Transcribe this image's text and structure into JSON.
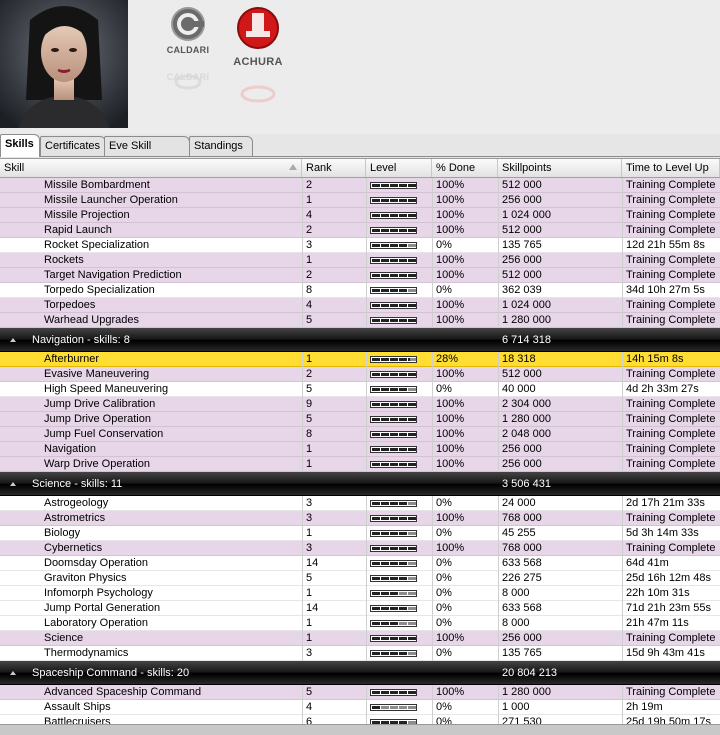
{
  "character": {
    "portrait_alt": "character-portrait"
  },
  "corps": [
    {
      "name": "CALDARI",
      "color": "#555555"
    },
    {
      "name": "ACHURA",
      "color": "#cc1111"
    }
  ],
  "tabs": [
    {
      "label": "Skills",
      "active": true
    },
    {
      "label": "Certificates",
      "active": false
    },
    {
      "label": "Eve Skill Queue",
      "active": false
    },
    {
      "label": "Standings",
      "active": false
    }
  ],
  "columns": [
    "Skill",
    "Rank",
    "Level",
    "% Done",
    "Skillpoints",
    "Time to Level Up"
  ],
  "rows": [
    {
      "type": "skill",
      "name": "Missile Bombardment",
      "rank": "2",
      "level": 5,
      "progress": 0,
      "done": "100%",
      "sp": "512 000",
      "time": "Training Complete"
    },
    {
      "type": "skill",
      "name": "Missile Launcher Operation",
      "rank": "1",
      "level": 5,
      "progress": 0,
      "done": "100%",
      "sp": "256 000",
      "time": "Training Complete"
    },
    {
      "type": "skill",
      "name": "Missile Projection",
      "rank": "4",
      "level": 5,
      "progress": 0,
      "done": "100%",
      "sp": "1 024 000",
      "time": "Training Complete"
    },
    {
      "type": "skill",
      "name": "Rapid Launch",
      "rank": "2",
      "level": 5,
      "progress": 0,
      "done": "100%",
      "sp": "512 000",
      "time": "Training Complete"
    },
    {
      "type": "skill",
      "name": "Rocket Specialization",
      "rank": "3",
      "level": 4,
      "progress": 0,
      "done": "0%",
      "sp": "135 765",
      "time": "12d 21h 55m 8s"
    },
    {
      "type": "skill",
      "name": "Rockets",
      "rank": "1",
      "level": 5,
      "progress": 0,
      "done": "100%",
      "sp": "256 000",
      "time": "Training Complete"
    },
    {
      "type": "skill",
      "name": "Target Navigation Prediction",
      "rank": "2",
      "level": 5,
      "progress": 0,
      "done": "100%",
      "sp": "512 000",
      "time": "Training Complete"
    },
    {
      "type": "skill",
      "name": "Torpedo Specialization",
      "rank": "8",
      "level": 4,
      "progress": 0,
      "done": "0%",
      "sp": "362 039",
      "time": "34d 10h 27m 5s"
    },
    {
      "type": "skill",
      "name": "Torpedoes",
      "rank": "4",
      "level": 5,
      "progress": 0,
      "done": "100%",
      "sp": "1 024 000",
      "time": "Training Complete"
    },
    {
      "type": "skill",
      "name": "Warhead Upgrades",
      "rank": "5",
      "level": 5,
      "progress": 0,
      "done": "100%",
      "sp": "1 280 000",
      "time": "Training Complete"
    },
    {
      "type": "group",
      "label": "Navigation - skills: 8",
      "sp": "6 714 318"
    },
    {
      "type": "skill",
      "name": "Afterburner",
      "rank": "1",
      "level": 4,
      "progress": 0.28,
      "done": "28%",
      "sp": "18 318",
      "time": "14h 15m 8s",
      "selected": true
    },
    {
      "type": "skill",
      "name": "Evasive Maneuvering",
      "rank": "2",
      "level": 5,
      "progress": 0,
      "done": "100%",
      "sp": "512 000",
      "time": "Training Complete"
    },
    {
      "type": "skill",
      "name": "High Speed Maneuvering",
      "rank": "5",
      "level": 4,
      "progress": 0,
      "done": "0%",
      "sp": "40 000",
      "time": "4d 2h 33m 27s"
    },
    {
      "type": "skill",
      "name": "Jump Drive Calibration",
      "rank": "9",
      "level": 5,
      "progress": 0,
      "done": "100%",
      "sp": "2 304 000",
      "time": "Training Complete"
    },
    {
      "type": "skill",
      "name": "Jump Drive Operation",
      "rank": "5",
      "level": 5,
      "progress": 0,
      "done": "100%",
      "sp": "1 280 000",
      "time": "Training Complete"
    },
    {
      "type": "skill",
      "name": "Jump Fuel Conservation",
      "rank": "8",
      "level": 5,
      "progress": 0,
      "done": "100%",
      "sp": "2 048 000",
      "time": "Training Complete"
    },
    {
      "type": "skill",
      "name": "Navigation",
      "rank": "1",
      "level": 5,
      "progress": 0,
      "done": "100%",
      "sp": "256 000",
      "time": "Training Complete"
    },
    {
      "type": "skill",
      "name": "Warp Drive Operation",
      "rank": "1",
      "level": 5,
      "progress": 0,
      "done": "100%",
      "sp": "256 000",
      "time": "Training Complete"
    },
    {
      "type": "group",
      "label": "Science - skills: 11",
      "sp": "3 506 431"
    },
    {
      "type": "skill",
      "name": "Astrogeology",
      "rank": "3",
      "level": 4,
      "progress": 0,
      "done": "0%",
      "sp": "24 000",
      "time": "2d 17h 21m 33s"
    },
    {
      "type": "skill",
      "name": "Astrometrics",
      "rank": "3",
      "level": 5,
      "progress": 0,
      "done": "100%",
      "sp": "768 000",
      "time": "Training Complete"
    },
    {
      "type": "skill",
      "name": "Biology",
      "rank": "1",
      "level": 4,
      "progress": 0,
      "done": "0%",
      "sp": "45 255",
      "time": "5d 3h 14m 33s"
    },
    {
      "type": "skill",
      "name": "Cybernetics",
      "rank": "3",
      "level": 5,
      "progress": 0,
      "done": "100%",
      "sp": "768 000",
      "time": "Training Complete"
    },
    {
      "type": "skill",
      "name": "Doomsday Operation",
      "rank": "14",
      "level": 4,
      "progress": 0,
      "done": "0%",
      "sp": "633 568",
      "time": "64d 41m"
    },
    {
      "type": "skill",
      "name": "Graviton Physics",
      "rank": "5",
      "level": 4,
      "progress": 0,
      "done": "0%",
      "sp": "226 275",
      "time": "25d 16h 12m 48s"
    },
    {
      "type": "skill",
      "name": "Infomorph Psychology",
      "rank": "1",
      "level": 3,
      "progress": 0,
      "done": "0%",
      "sp": "8 000",
      "time": "22h 10m 31s"
    },
    {
      "type": "skill",
      "name": "Jump Portal Generation",
      "rank": "14",
      "level": 4,
      "progress": 0,
      "done": "0%",
      "sp": "633 568",
      "time": "71d 21h 23m 55s"
    },
    {
      "type": "skill",
      "name": "Laboratory Operation",
      "rank": "1",
      "level": 3,
      "progress": 0,
      "done": "0%",
      "sp": "8 000",
      "time": "21h 47m 11s"
    },
    {
      "type": "skill",
      "name": "Science",
      "rank": "1",
      "level": 5,
      "progress": 0,
      "done": "100%",
      "sp": "256 000",
      "time": "Training Complete"
    },
    {
      "type": "skill",
      "name": "Thermodynamics",
      "rank": "3",
      "level": 4,
      "progress": 0,
      "done": "0%",
      "sp": "135 765",
      "time": "15d 9h 43m 41s"
    },
    {
      "type": "group",
      "label": "Spaceship Command - skills: 20",
      "sp": "20 804 213"
    },
    {
      "type": "skill",
      "name": "Advanced Spaceship Command",
      "rank": "5",
      "level": 5,
      "progress": 0,
      "done": "100%",
      "sp": "1 280 000",
      "time": "Training Complete"
    },
    {
      "type": "skill",
      "name": "Assault Ships",
      "rank": "4",
      "level": 1,
      "progress": 0,
      "done": "0%",
      "sp": "1 000",
      "time": "2h 19m"
    },
    {
      "type": "skill",
      "name": "Battlecruisers",
      "rank": "6",
      "level": 4,
      "progress": 0,
      "done": "0%",
      "sp": "271 530",
      "time": "25d 19h 50m 17s"
    }
  ],
  "colors": {
    "trained": "#e6d6e8",
    "selected": "#ffdd33",
    "group": "#000000"
  }
}
